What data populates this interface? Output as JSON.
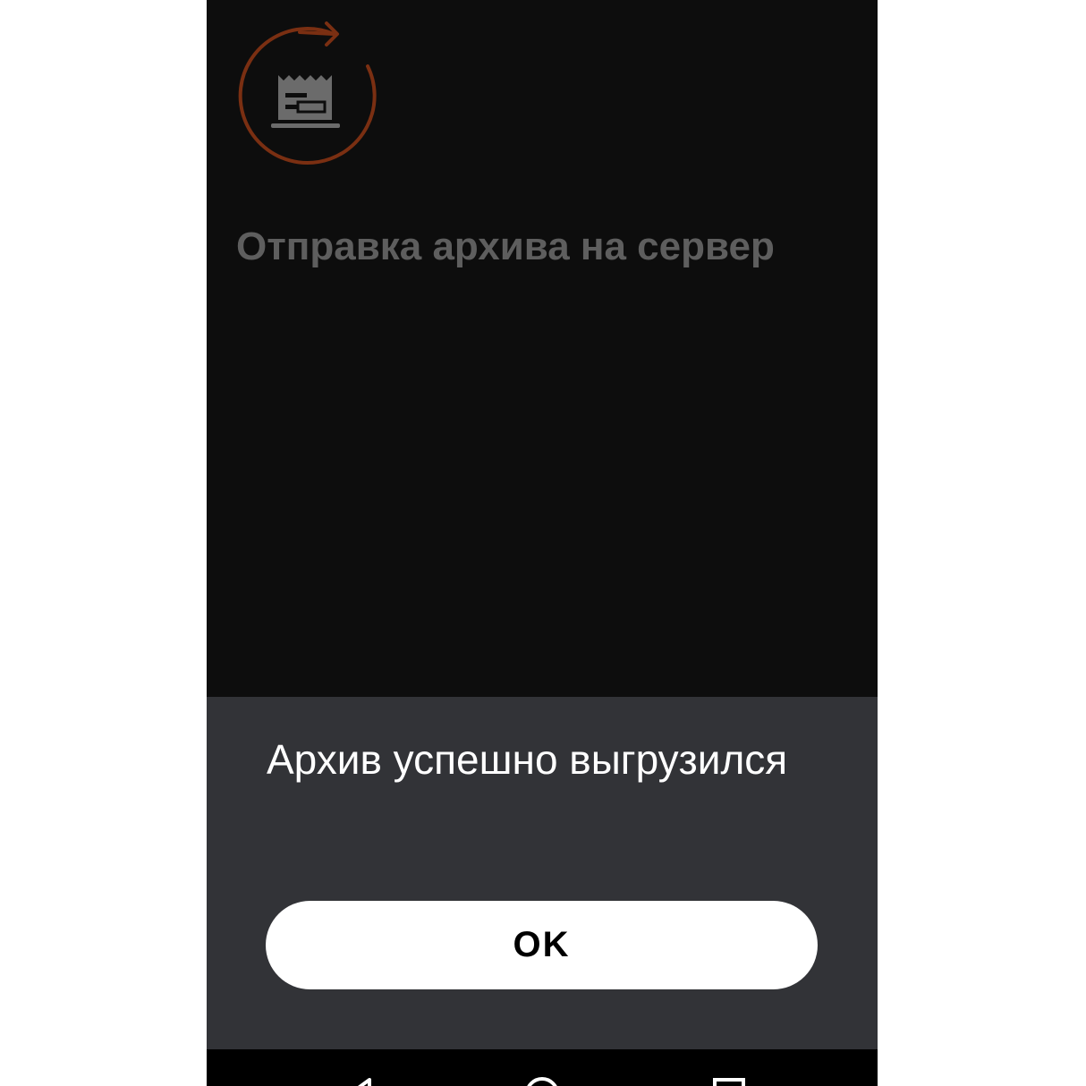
{
  "screen": {
    "title": "Отправка архива на сервер",
    "icon": "archive-sync-icon"
  },
  "dialog": {
    "message": "Архив успешно выгрузился",
    "ok_label": "OK"
  },
  "navigation_bar": {
    "back": "back-icon",
    "home": "home-icon",
    "recent": "recent-apps-icon"
  },
  "colors": {
    "background": "#0d0d0d",
    "accent_ring": "#7a2f12",
    "icon_gray": "#6b6b6b",
    "title_gray": "#5e5e5e",
    "sheet": "#323337",
    "button": "#ffffff"
  }
}
